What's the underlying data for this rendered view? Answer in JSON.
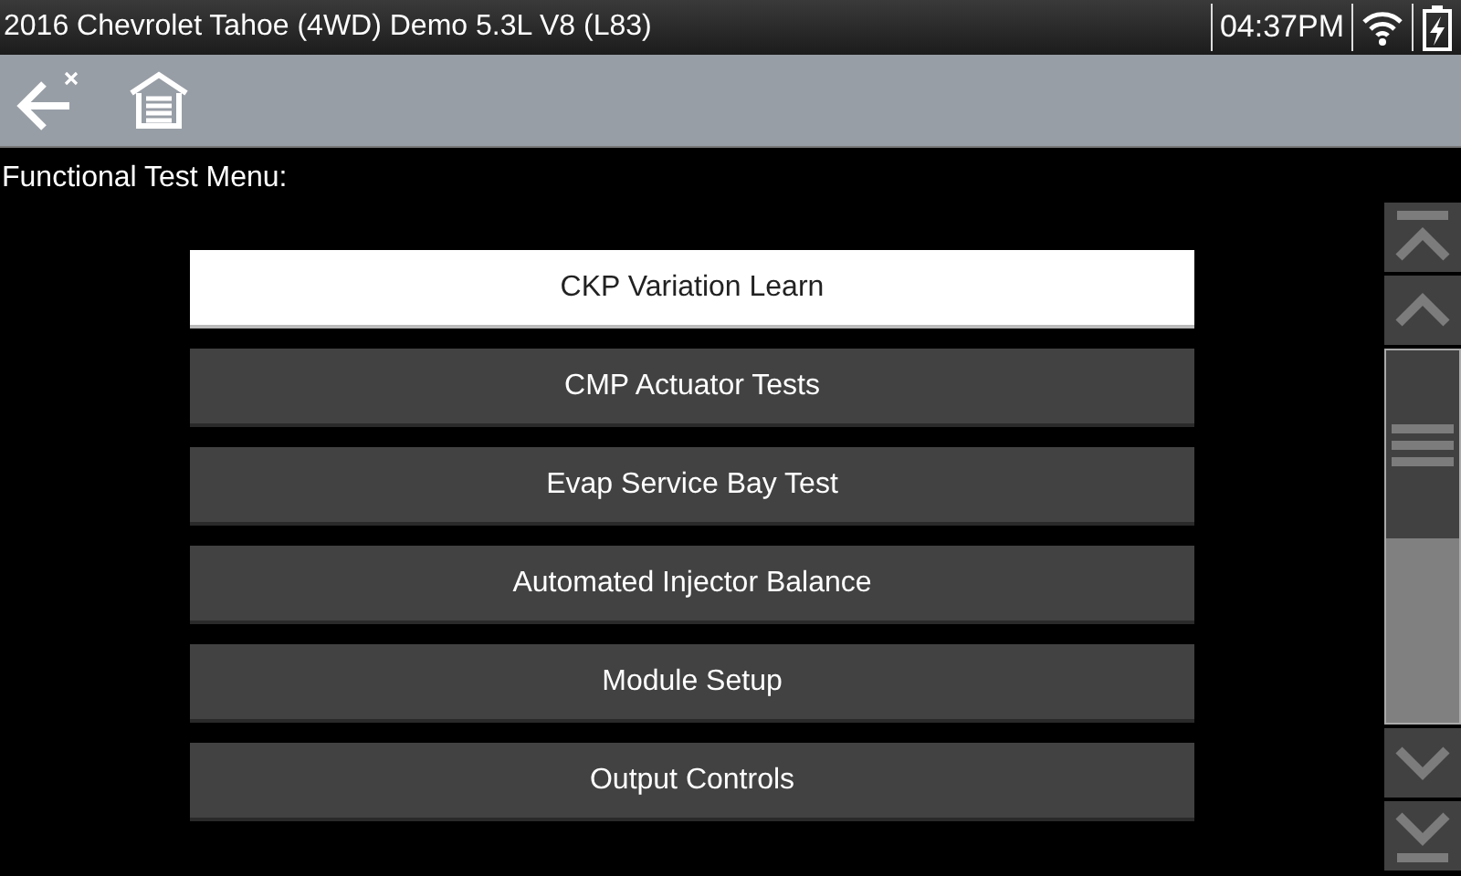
{
  "status_bar": {
    "title": "2016 Chevrolet Tahoe (4WD) Demo 5.3L V8 (L83)",
    "time": "04:37PM"
  },
  "heading": "Functional Test Menu:",
  "menu": [
    {
      "label": "CKP Variation Learn",
      "selected": true
    },
    {
      "label": "CMP Actuator Tests",
      "selected": false
    },
    {
      "label": "Evap Service Bay Test",
      "selected": false
    },
    {
      "label": "Automated Injector Balance",
      "selected": false
    },
    {
      "label": "Module Setup",
      "selected": false
    },
    {
      "label": "Output Controls",
      "selected": false
    }
  ]
}
